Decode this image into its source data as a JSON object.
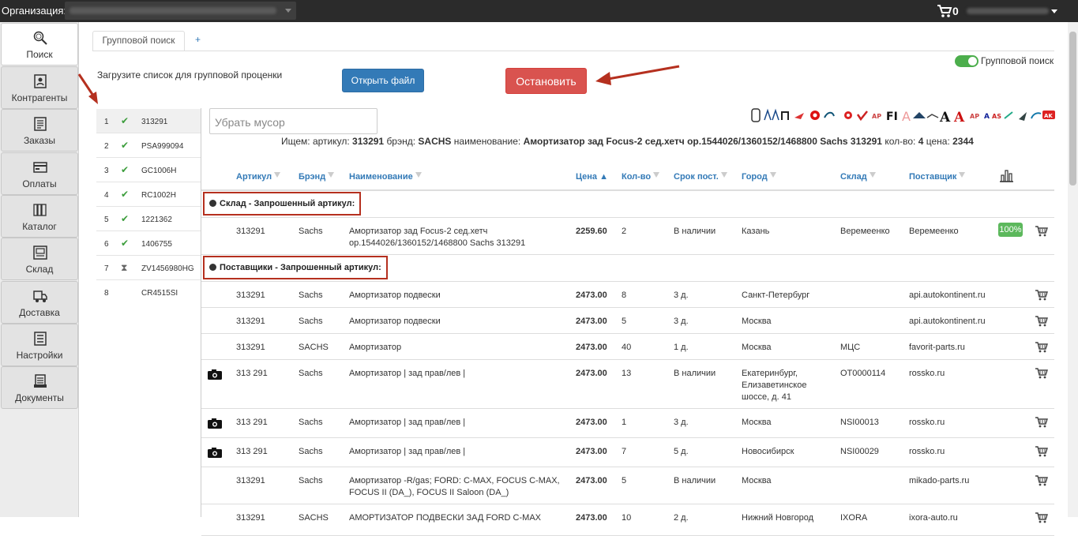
{
  "header": {
    "org_label": "Организация:",
    "cart_count": "0"
  },
  "sidebar": {
    "items": [
      {
        "label": "Поиск",
        "icon": "search-icon"
      },
      {
        "label": "Контрагенты",
        "icon": "contacts-icon"
      },
      {
        "label": "Заказы",
        "icon": "orders-icon"
      },
      {
        "label": "Оплаты",
        "icon": "payments-icon"
      },
      {
        "label": "Каталог",
        "icon": "catalog-icon"
      },
      {
        "label": "Склад",
        "icon": "warehouse-icon"
      },
      {
        "label": "Доставка",
        "icon": "delivery-icon"
      },
      {
        "label": "Настройки",
        "icon": "settings-icon"
      },
      {
        "label": "Документы",
        "icon": "documents-icon"
      }
    ]
  },
  "tabs": {
    "active": "Групповой поиск",
    "add": "+"
  },
  "upload": {
    "label": "Загрузите список для групповой проценки",
    "open_file": "Открыть файл",
    "stop": "Остановить",
    "group_search_toggle": "Групповой поиск"
  },
  "group_list": [
    {
      "num": "1",
      "status": "✔",
      "code": "313291"
    },
    {
      "num": "2",
      "status": "✔",
      "code": "PSA999094"
    },
    {
      "num": "3",
      "status": "✔",
      "code": "GC1006H"
    },
    {
      "num": "4",
      "status": "✔",
      "code": "RC1002H"
    },
    {
      "num": "5",
      "status": "✔",
      "code": "1221362"
    },
    {
      "num": "6",
      "status": "✔",
      "code": "1406755"
    },
    {
      "num": "7",
      "status": "⧗",
      "code": "ZV1456980HG"
    },
    {
      "num": "8",
      "status": "",
      "code": "CR4515SI"
    }
  ],
  "filter": {
    "placeholder": "Убрать мусор"
  },
  "summary": {
    "prefix": "Ищем: артикул:",
    "article": "313291",
    "brand_label": "брэнд:",
    "brand": "SACHS",
    "name_label": "наименование:",
    "name": "Амортизатор зад Focus-2 сед.хетч ор.1544026/1360152/1468800 Sachs 313291",
    "qty_label": "кол-во:",
    "qty": "4",
    "price_label": "цена:",
    "price": "2344"
  },
  "columns": {
    "article": "Артикул",
    "brand": "Брэнд",
    "name": "Наименование",
    "price": "Цена ▲",
    "qty": "Кол-во",
    "term": "Срок пост.",
    "city": "Город",
    "stock": "Склад",
    "supplier": "Поставщик"
  },
  "groups": {
    "warehouse": "Склад - Запрошенный артикул:",
    "suppliers": "Поставщики - Запрошенный артикул:"
  },
  "warehouse_rows": [
    {
      "article": "313291",
      "brand": "Sachs",
      "name": "Амортизатор зад Focus-2 сед.хетч ор.1544026/1360152/1468800 Sachs 313291",
      "price": "2259.60",
      "qty": "2",
      "term": "В наличии",
      "city": "Казань",
      "stock": "Веремеенко",
      "supplier": "Веремеенко",
      "pct": "100%"
    }
  ],
  "supplier_rows": [
    {
      "article": "313291",
      "brand": "Sachs",
      "name": "Амортизатор подвески",
      "price": "2473.00",
      "qty": "8",
      "term": "3 д.",
      "city": "Санкт-Петербург",
      "stock": "",
      "supplier": "api.autokontinent.ru",
      "photo": false
    },
    {
      "article": "313291",
      "brand": "Sachs",
      "name": "Амортизатор подвески",
      "price": "2473.00",
      "qty": "5",
      "term": "3 д.",
      "city": "Москва",
      "stock": "",
      "supplier": "api.autokontinent.ru",
      "photo": false
    },
    {
      "article": "313291",
      "brand": "SACHS",
      "name": "Амортизатор",
      "price": "2473.00",
      "qty": "40",
      "term": "1 д.",
      "city": "Москва",
      "stock": "МЦС",
      "supplier": "favorit-parts.ru",
      "photo": false
    },
    {
      "article": "313 291",
      "brand": "Sachs",
      "name": "Амортизатор | зад прав/лев |",
      "price": "2473.00",
      "qty": "13",
      "term": "В наличии",
      "city": "Екатеринбург, Елизаветинское шоссе, д. 41",
      "stock": "ОТ0000114",
      "supplier": "rossko.ru",
      "photo": true
    },
    {
      "article": "313 291",
      "brand": "Sachs",
      "name": "Амортизатор | зад прав/лев |",
      "price": "2473.00",
      "qty": "1",
      "term": "3 д.",
      "city": "Москва",
      "stock": "NSI00013",
      "supplier": "rossko.ru",
      "photo": true
    },
    {
      "article": "313 291",
      "brand": "Sachs",
      "name": "Амортизатор | зад прав/лев |",
      "price": "2473.00",
      "qty": "7",
      "term": "5 д.",
      "city": "Новосибирск",
      "stock": "NSI00029",
      "supplier": "rossko.ru",
      "photo": true
    },
    {
      "article": "313291",
      "brand": "Sachs",
      "name": "Амортизатор -R/gas; FORD: C-MAX, FOCUS C-MAX, FOCUS II (DA_), FOCUS II Saloon (DA_)",
      "price": "2473.00",
      "qty": "5",
      "term": "В наличии",
      "city": "Москва",
      "stock": "",
      "supplier": "mikado-parts.ru",
      "photo": false
    },
    {
      "article": "313291",
      "brand": "SACHS",
      "name": "АМОРТИЗАТОР ПОДВЕСКИ ЗАД FORD C-MAX",
      "price": "2473.00",
      "qty": "10",
      "term": "2 д.",
      "city": "Нижний Новгород",
      "stock": "IXORA",
      "supplier": "ixora-auto.ru",
      "photo": false
    }
  ],
  "colors": {
    "primary": "#337ab7",
    "danger": "#d9534f",
    "success": "#5cb85c",
    "highlight": "#b5301f"
  }
}
